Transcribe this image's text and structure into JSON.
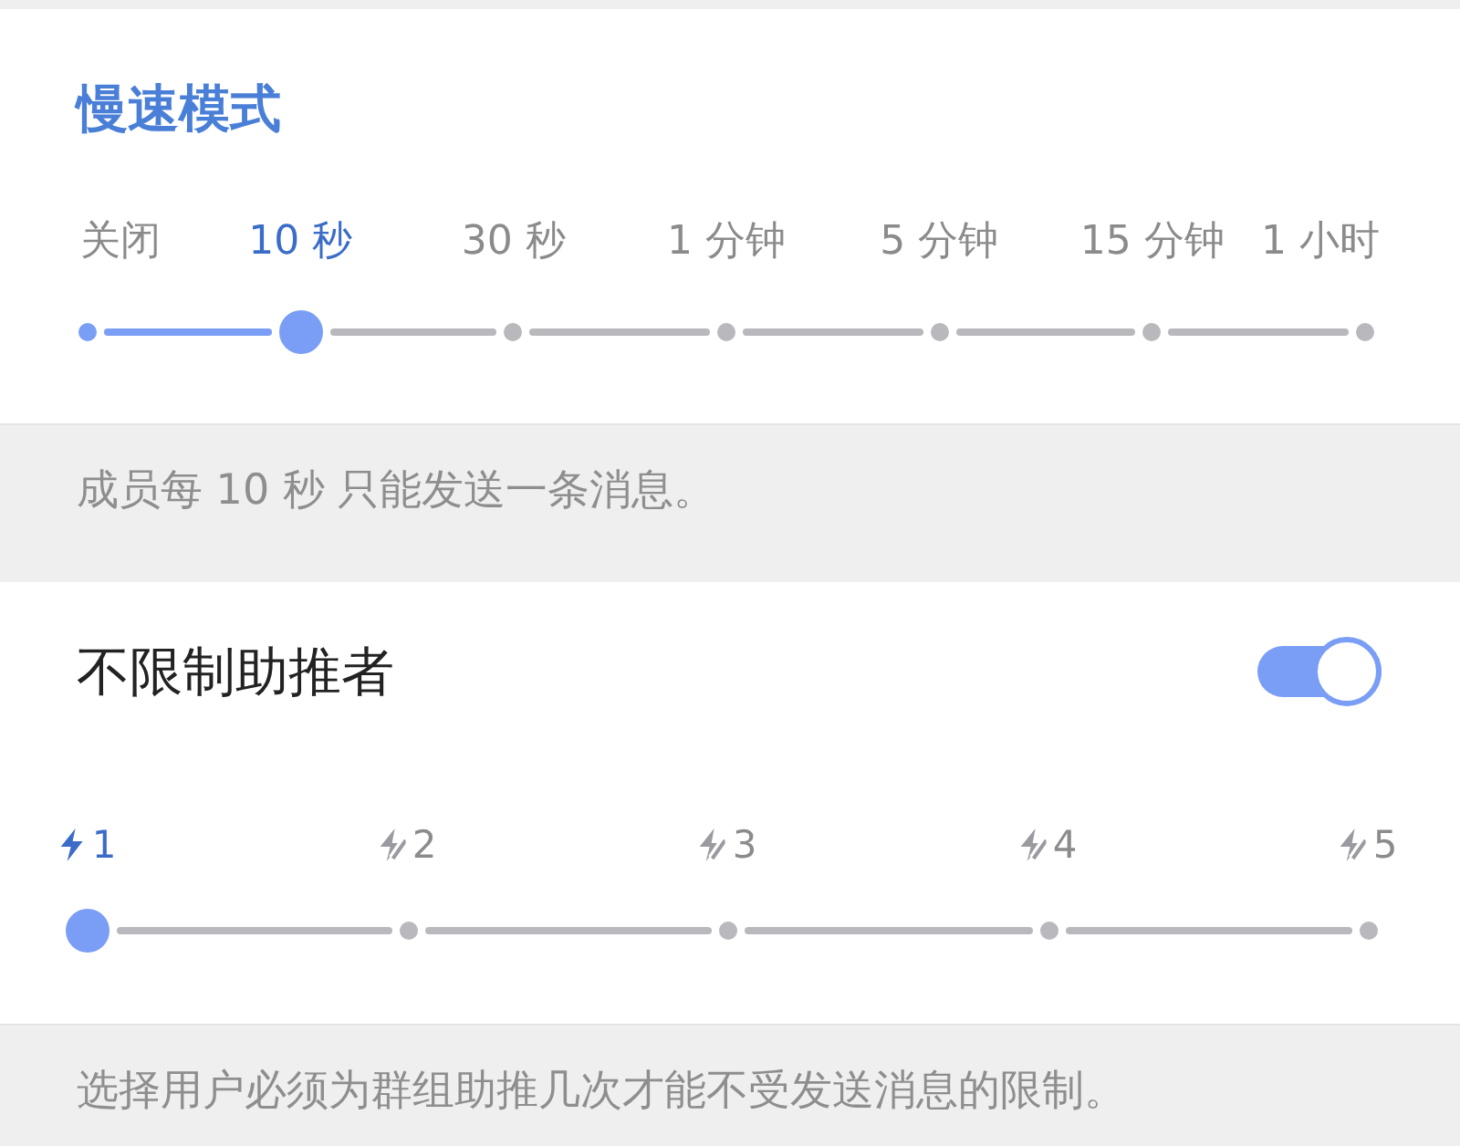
{
  "slow_mode": {
    "title": "慢速模式",
    "options": [
      {
        "label": "关闭",
        "selected": false
      },
      {
        "label": "10 秒",
        "selected": true
      },
      {
        "label": "30 秒",
        "selected": false
      },
      {
        "label": "1 分钟",
        "selected": false
      },
      {
        "label": "5 分钟",
        "selected": false
      },
      {
        "label": "15 分钟",
        "selected": false
      },
      {
        "label": "1 小时",
        "selected": false
      }
    ]
  },
  "slow_mode_note": "成员每 10 秒 只能发送一条消息。",
  "boosters": {
    "label": "不限制助推者",
    "on": true,
    "options": [
      {
        "label": "1",
        "selected": true
      },
      {
        "label": "2",
        "selected": false
      },
      {
        "label": "3",
        "selected": false
      },
      {
        "label": "4",
        "selected": false
      },
      {
        "label": "5",
        "selected": false
      }
    ]
  },
  "boosters_note": "选择用户必须为群组助推几次才能不受发送消息的限制。"
}
